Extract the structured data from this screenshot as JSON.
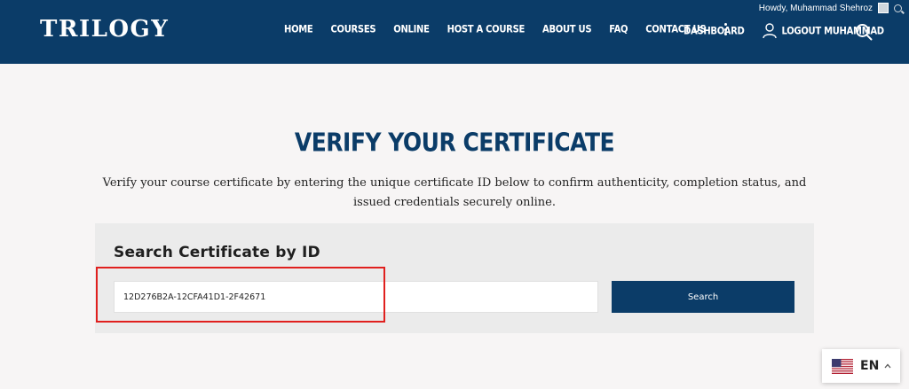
{
  "brand": {
    "logo_text": "TRILOGY"
  },
  "admin_bar": {
    "greeting": "Howdy, Muhammad Shehroz"
  },
  "nav": {
    "items": [
      "HOME",
      "COURSES",
      "ONLINE",
      "HOST A COURSE",
      "ABOUT US",
      "FAQ",
      "CONTACT US"
    ],
    "dashboard": "DASHBOARD",
    "logout": "LOGOUT MUHAMMAD"
  },
  "main": {
    "title": "VERIFY YOUR CERTIFICATE",
    "description": "Verify your course certificate by entering the unique certificate ID below to confirm authenticity, completion status, and issued credentials securely online."
  },
  "search": {
    "heading": "Search Certificate by ID",
    "input_value": "12D276B2A-12CFA41D1-2F42671",
    "button_label": "Search"
  },
  "language": {
    "code": "EN"
  },
  "colors": {
    "brand": "#0b3c68",
    "highlight": "#e0201e",
    "background": "#f7f5f5",
    "card": "#ebebeb"
  }
}
